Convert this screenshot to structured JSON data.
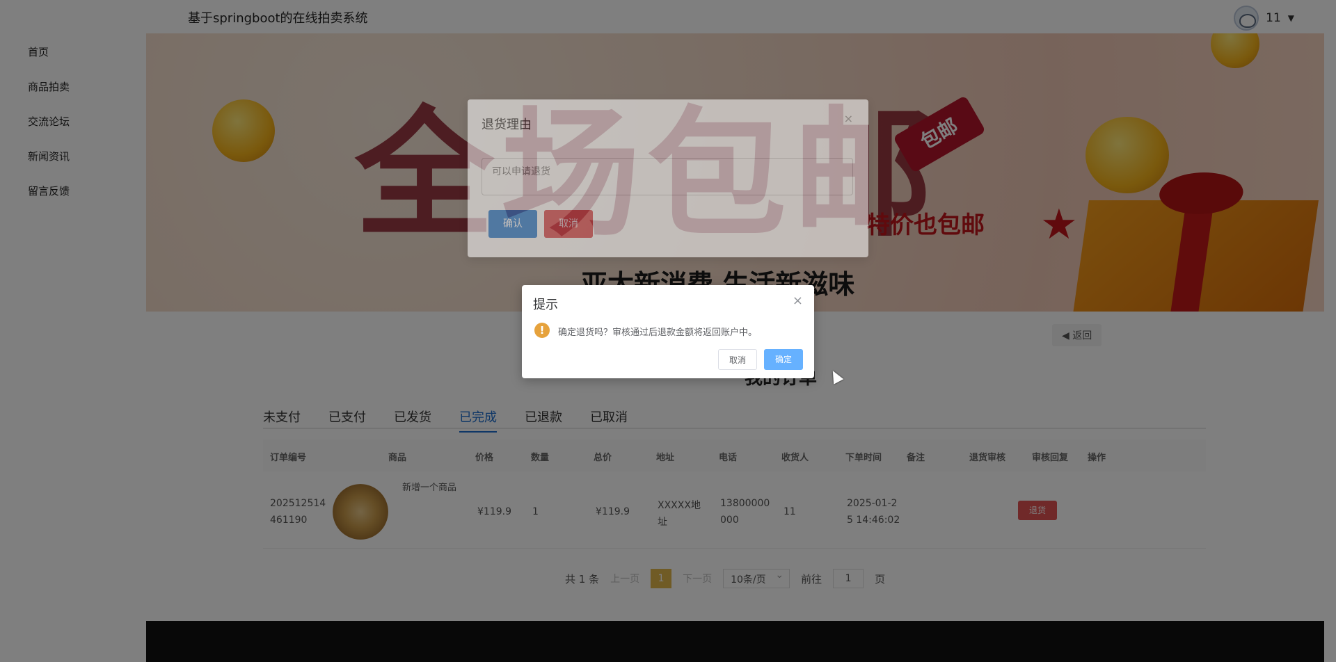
{
  "header": {
    "site_title": "基于springboot的在线拍卖系统",
    "username": "11"
  },
  "sidebar": {
    "items": [
      {
        "label": "首页"
      },
      {
        "label": "商品拍卖"
      },
      {
        "label": "交流论坛"
      },
      {
        "label": "新闻资讯"
      },
      {
        "label": "留言反馈"
      }
    ]
  },
  "banner": {
    "subtext": "特价也包邮",
    "slogan": "亚太新消费 生活新滋味",
    "tag": "包邮",
    "headline": "全场包邮"
  },
  "page": {
    "back_label": "返回",
    "title": "我的订单"
  },
  "tabs": [
    {
      "label": "未支付"
    },
    {
      "label": "已支付"
    },
    {
      "label": "已发货"
    },
    {
      "label": "已完成"
    },
    {
      "label": "已退款"
    },
    {
      "label": "已取消"
    }
  ],
  "table": {
    "headers": [
      "订单编号",
      "商品",
      "价格",
      "数量",
      "总价",
      "地址",
      "电话",
      "收货人",
      "下单时间",
      "备注",
      "退货审核",
      "审核回复",
      "操作"
    ],
    "rows": [
      {
        "order_no_1": "202512514",
        "order_no_2": "461190",
        "product": "新增一个商品",
        "price": "¥119.9",
        "qty": "1",
        "total": "¥119.9",
        "address_1": "XXXXX地",
        "address_2": "址",
        "phone_1": "13800000",
        "phone_2": "000",
        "receiver": "11",
        "time_1": "2025-01-2",
        "time_2": "5 14:46:02",
        "action": "退货"
      }
    ]
  },
  "pagination": {
    "total": "共 1 条",
    "prev": "上一页",
    "current": "1",
    "next": "下一页",
    "page_size": "10条/页",
    "goto_prefix": "前往",
    "goto_value": "1",
    "goto_suffix": "页"
  },
  "refund_dialog": {
    "title": "退货理由",
    "close": "×",
    "placeholder": "可以申请退货",
    "confirm": "确认",
    "cancel": "取消"
  },
  "confirm_dialog": {
    "title": "提示",
    "close": "×",
    "message": "确定退货吗？审核通过后退款金额将返回账户中。",
    "cancel": "取消",
    "ok": "确定"
  },
  "colors": {
    "accent": "#1e6fcf",
    "danger": "#e05252",
    "warn": "#e6a23c",
    "primary_light": "#66b1ff"
  }
}
